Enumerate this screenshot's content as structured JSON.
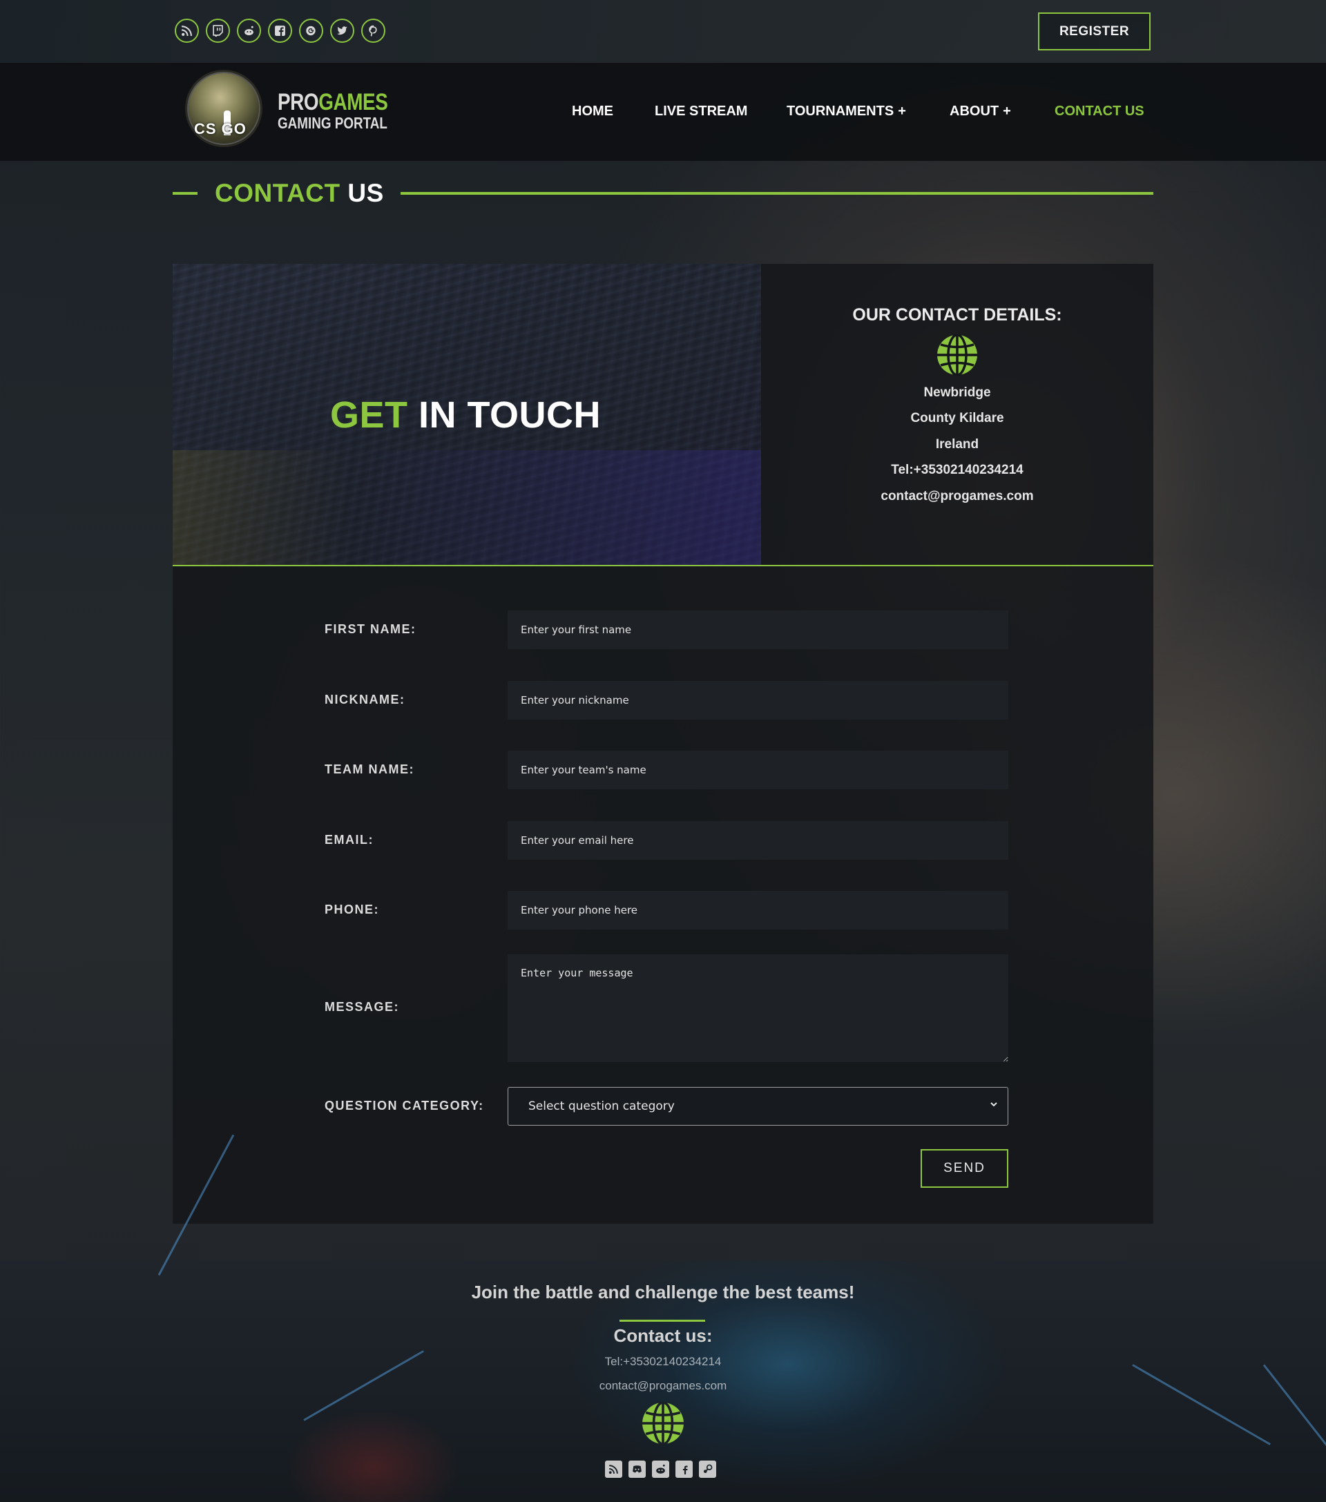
{
  "header": {
    "social_icons": [
      "rss-icon",
      "twitch-icon",
      "reddit-icon",
      "facebook-icon",
      "google-plus-icon",
      "twitter-icon",
      "pinterest-icon"
    ],
    "register_label": "REGISTER"
  },
  "logo": {
    "badge_text": "CS GO",
    "name_part1": "PRO",
    "name_part2": "GAMES",
    "tagline": "GAMING PORTAL"
  },
  "nav": {
    "items": [
      {
        "label": "HOME",
        "has_submenu": false,
        "active": false
      },
      {
        "label": "LIVE STREAM",
        "has_submenu": false,
        "active": false
      },
      {
        "label": "TOURNAMENTS",
        "has_submenu": true,
        "active": false
      },
      {
        "label": "ABOUT",
        "has_submenu": true,
        "active": false
      },
      {
        "label": "CONTACT US",
        "has_submenu": false,
        "active": true
      }
    ],
    "submenu_indicator": "+"
  },
  "page": {
    "title_part1": "CONTACT",
    "title_part2": "US"
  },
  "hero": {
    "title_part1": "GET",
    "title_part2": "IN TOUCH"
  },
  "contact_details": {
    "title": "OUR CONTACT DETAILS:",
    "icon": "globe-icon",
    "lines": [
      "Newbridge",
      "County Kildare",
      "Ireland",
      "Tel:+35302140234214",
      "contact@progames.com"
    ]
  },
  "form": {
    "first_name": {
      "label": "FIRST NAME:",
      "placeholder": "Enter your first name",
      "value": ""
    },
    "nickname": {
      "label": "NICKNAME:",
      "placeholder": "Enter your nickname",
      "value": ""
    },
    "team_name": {
      "label": "TEAM NAME:",
      "placeholder": "Enter your team's name",
      "value": ""
    },
    "email": {
      "label": "EMAIL:",
      "placeholder": "Enter your email here",
      "value": ""
    },
    "phone": {
      "label": "PHONE:",
      "placeholder": "Enter your phone here",
      "value": ""
    },
    "message": {
      "label": "MESSAGE:",
      "placeholder": "Enter your message",
      "value": ""
    },
    "category": {
      "label": "QUESTION CATEGORY:",
      "selected": "Select question category"
    },
    "send_label": "SEND"
  },
  "footer": {
    "heading": "Join the battle and challenge the best teams!",
    "contact_heading": "Contact us:",
    "tel": "Tel:+35302140234214",
    "email": "contact@progames.com",
    "icon": "globe-icon",
    "social_icons": [
      "rss-icon",
      "discord-icon",
      "reddit-icon",
      "facebook-icon",
      "steam-icon"
    ]
  },
  "colors": {
    "accent": "#8dc63f",
    "panel_bg": "#14171a",
    "input_bg": "#1e2227",
    "text": "#e8e8e8"
  }
}
